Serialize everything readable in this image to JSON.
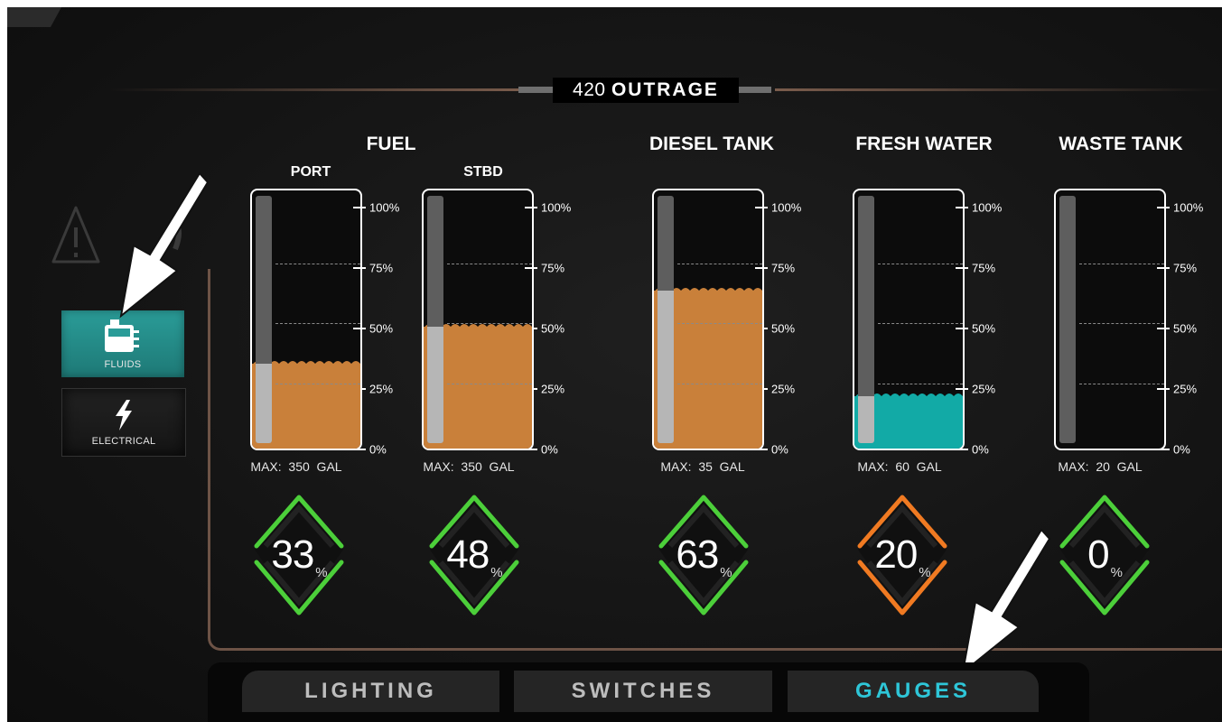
{
  "header": {
    "title_number": "420",
    "title_name": "OUTRAGE"
  },
  "sidebar": {
    "fluids_label": "FLUIDS",
    "electrical_label": "ELECTRICAL"
  },
  "groups": {
    "fuel": "FUEL",
    "diesel": "DIESEL TANK",
    "fresh": "FRESH WATER",
    "waste": "WASTE TANK"
  },
  "tanks": [
    {
      "name": "PORT",
      "max": "MAX:  350  GAL",
      "level": "33",
      "fill_fraction": 0.33,
      "fluid_color": "#c9803a",
      "status_color": "#4ccf3a"
    },
    {
      "name": "STBD",
      "max": "MAX:  350  GAL",
      "level": "48",
      "fill_fraction": 0.48,
      "fluid_color": "#c9803a",
      "status_color": "#4ccf3a"
    },
    {
      "name": "DIESEL TANK",
      "max": "MAX:  35  GAL",
      "level": "63",
      "fill_fraction": 0.63,
      "fluid_color": "#c9803a",
      "status_color": "#4ccf3a"
    },
    {
      "name": "FRESH WATER",
      "max": "MAX:  60  GAL",
      "level": "20",
      "fill_fraction": 0.2,
      "fluid_color": "#12aaa6",
      "status_color": "#f07a22"
    },
    {
      "name": "WASTE TANK",
      "max": "MAX:  20  GAL",
      "level": "0",
      "fill_fraction": 0.0,
      "fluid_color": "#c9803a",
      "status_color": "#4ccf3a"
    }
  ],
  "scale_labels": [
    "100%",
    "75%",
    "50%",
    "25%",
    "0%"
  ],
  "percent_symbol": "%",
  "tabs": {
    "lighting": "LIGHTING",
    "switches": "SWITCHES",
    "gauges": "GAUGES"
  },
  "colors": {
    "accent_teal": "#2a9c98",
    "active_tab": "#2ec6d8",
    "frame": "#6d5346"
  }
}
